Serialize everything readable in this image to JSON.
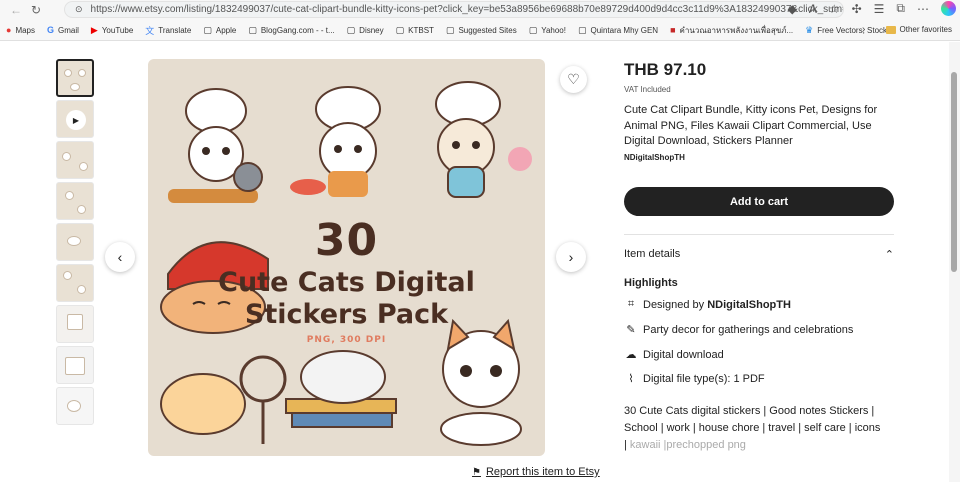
{
  "browser": {
    "url": "https://www.etsy.com/listing/1832499037/cute-cat-clipart-bundle-kitty-icons-pet?click_key=be53a8956be69688b70e89729d400d9d4cc3c11d9%3A1832499037&click_sum=...",
    "bookmarks": [
      "Maps",
      "Gmail",
      "YouTube",
      "Translate",
      "Apple",
      "BlogGang.com - - t...",
      "Disney",
      "KTBST",
      "Suggested Sites",
      "Yahoo!",
      "Quintara Mhy GEN",
      "คำนวณอาหารพลังงานเพื่อสุขภ์...",
      "Free Vectors, Stock..."
    ],
    "other_favorites": "Other favorites"
  },
  "listing": {
    "price": "THB 97.10",
    "vat": "VAT Included",
    "title": "Cute Cat Clipart Bundle, Kitty icons Pet, Designs for Animal PNG, Files Kawaii Clipart Commercial, Use Digital Download, Stickers Planner",
    "shop": "NDigitalShopTH",
    "add_to_cart": "Add to cart",
    "item_details": "Item details",
    "highlights_label": "Highlights",
    "highlights": {
      "designed_by_prefix": "Designed by ",
      "designed_by_shop": "NDigitalShopTH",
      "party": "Party decor for gatherings and celebrations",
      "download": "Digital download",
      "filetypes": "Digital file type(s): 1 PDF"
    },
    "description": "30 Cute Cats digital stickers | Good notes Stickers | School | work | house chore | travel | self care | icons |",
    "description_fade": "kawaii |prechopped png",
    "report": "Report this item to Etsy"
  },
  "image_text": {
    "number": "30",
    "line1": "Cute Cats Digital",
    "line2": "Stickers Pack",
    "subtitle": "PNG, 300 DPI"
  }
}
